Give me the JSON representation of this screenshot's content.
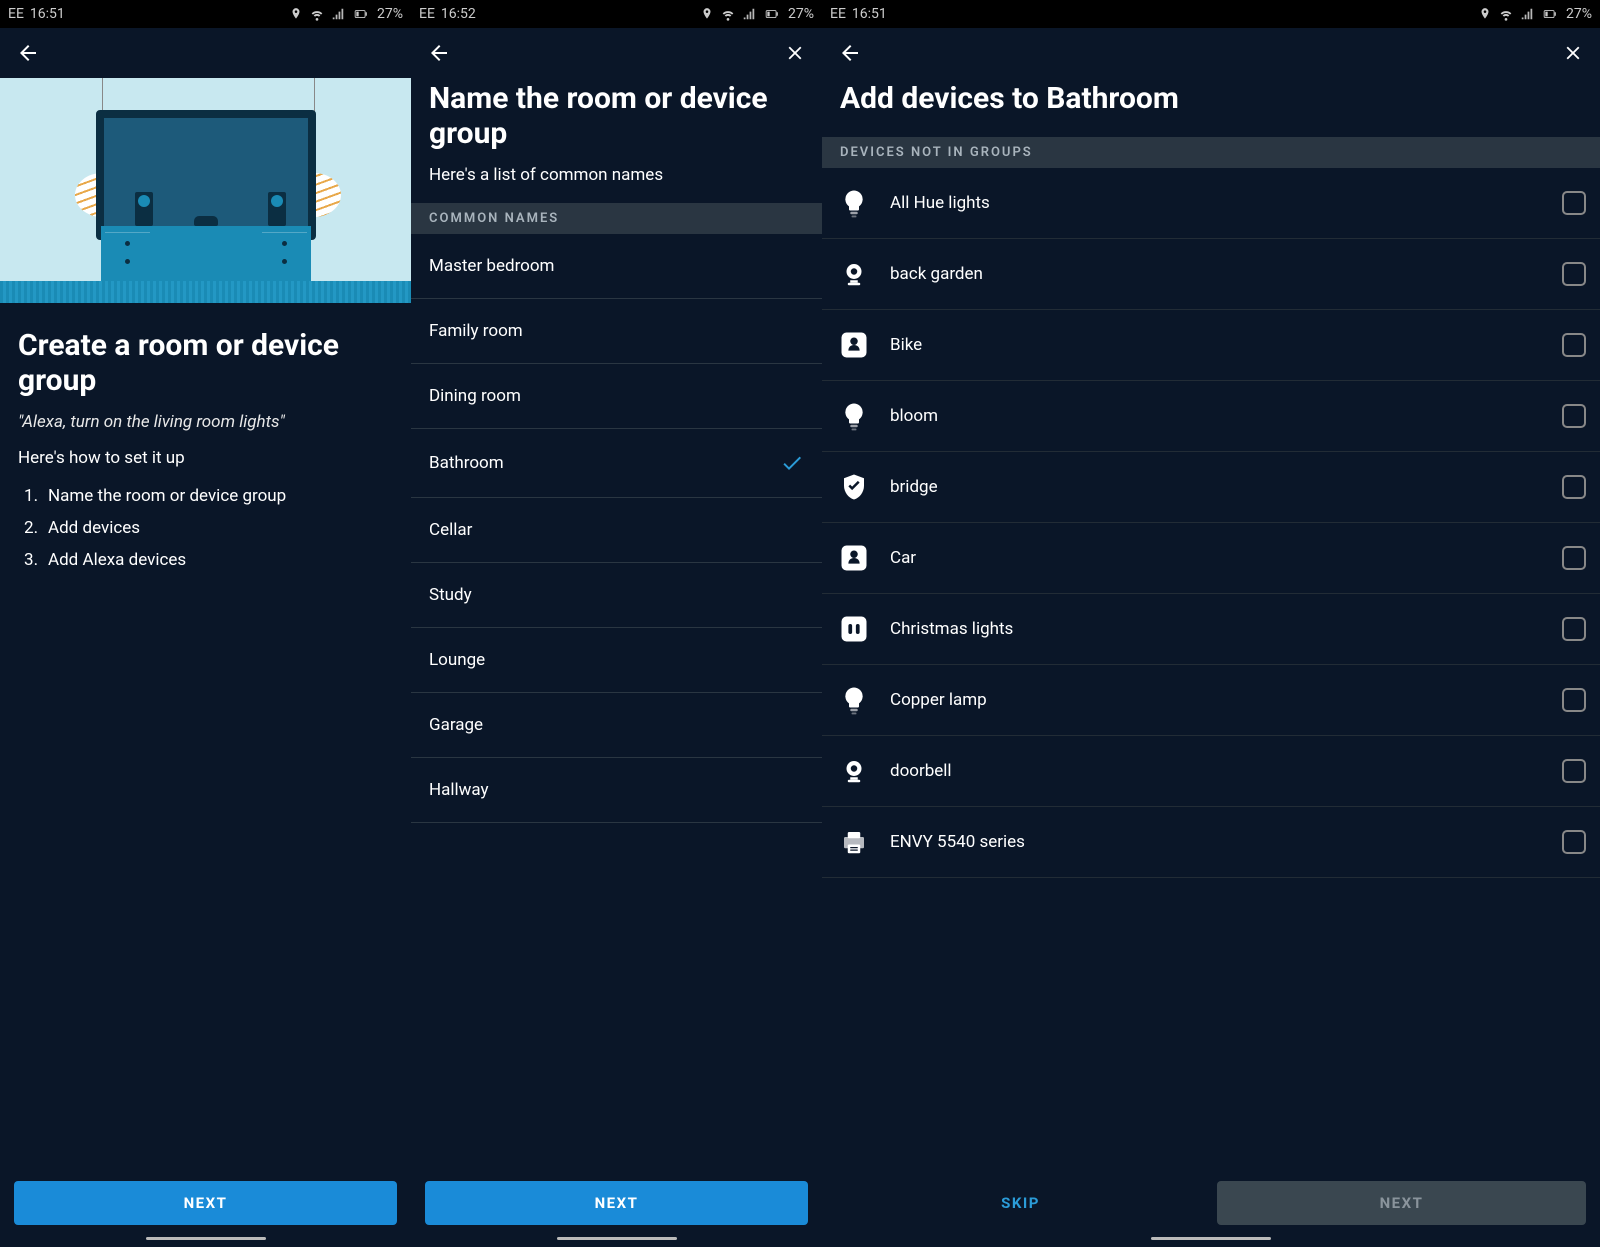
{
  "statusbar": {
    "carrier": "EE",
    "time1": "16:51",
    "time2": "16:52",
    "time3": "16:51",
    "battery": "27%"
  },
  "screen1": {
    "title": "Create a room or device group",
    "quote": "\"Alexa, turn on the living room lights\"",
    "subtext": "Here's how to set it up",
    "steps": [
      "Name the room or device group",
      "Add devices",
      "Add Alexa devices"
    ],
    "next": "NEXT"
  },
  "screen2": {
    "title": "Name the room or device group",
    "subtext": "Here's a list of common names",
    "section": "COMMON NAMES",
    "names": [
      {
        "label": "Master bedroom",
        "selected": false
      },
      {
        "label": "Family room",
        "selected": false
      },
      {
        "label": "Dining room",
        "selected": false
      },
      {
        "label": "Bathroom",
        "selected": true
      },
      {
        "label": "Cellar",
        "selected": false
      },
      {
        "label": "Study",
        "selected": false
      },
      {
        "label": "Lounge",
        "selected": false
      },
      {
        "label": "Garage",
        "selected": false
      },
      {
        "label": "Hallway",
        "selected": false
      }
    ],
    "next": "NEXT"
  },
  "screen3": {
    "title": "Add devices to Bathroom",
    "section": "DEVICES NOT IN GROUPS",
    "devices": [
      {
        "label": "All Hue lights",
        "icon": "bulb"
      },
      {
        "label": "back garden",
        "icon": "camera"
      },
      {
        "label": "Bike",
        "icon": "tile"
      },
      {
        "label": "bloom",
        "icon": "bulb"
      },
      {
        "label": "bridge",
        "icon": "shield"
      },
      {
        "label": "Car",
        "icon": "tile"
      },
      {
        "label": "Christmas lights",
        "icon": "plug"
      },
      {
        "label": "Copper lamp",
        "icon": "bulb"
      },
      {
        "label": "doorbell",
        "icon": "camera"
      },
      {
        "label": "ENVY 5540 series",
        "icon": "printer"
      }
    ],
    "skip": "SKIP",
    "next": "NEXT"
  }
}
